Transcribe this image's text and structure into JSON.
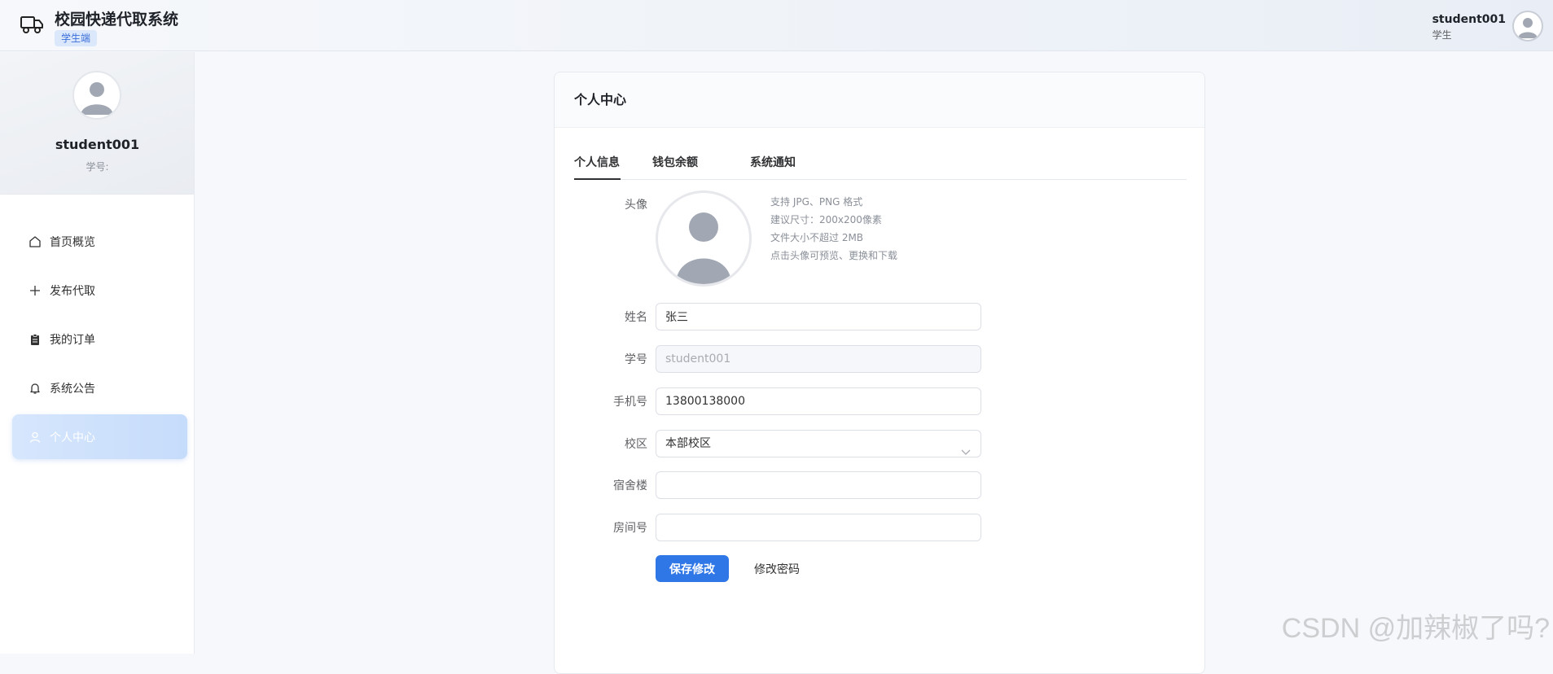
{
  "app": {
    "title": "校园快递代取系统",
    "role_tag": "学生端",
    "user_name": "student001",
    "user_role": "学生"
  },
  "sidebar": {
    "profile_name": "student001",
    "profile_sid_label": "学号:",
    "items": [
      {
        "label": "首页概览",
        "icon": "home-icon"
      },
      {
        "label": "发布代取",
        "icon": "plus-icon"
      },
      {
        "label": "我的订单",
        "icon": "clipboard-icon"
      },
      {
        "label": "系统公告",
        "icon": "bell-icon"
      },
      {
        "label": "个人中心",
        "icon": "user-icon",
        "active": true
      }
    ]
  },
  "card": {
    "title": "个人中心",
    "tabs": [
      "个人信息",
      "钱包余额",
      "系统通知"
    ],
    "active_tab": "个人信息"
  },
  "form": {
    "avatar_label": "头像",
    "tips": [
      "支持 JPG、PNG 格式",
      "建议尺寸：200x200像素",
      "文件大小不超过 2MB",
      "点击头像可预览、更换和下载"
    ],
    "name_label": "姓名",
    "name_value": "张三",
    "sid_label": "学号",
    "sid_value": "student001",
    "phone_label": "手机号",
    "phone_value": "13800138000",
    "campus_label": "校区",
    "campus_value": "本部校区",
    "dorm_label": "宿舍楼",
    "dorm_value": "",
    "room_label": "房间号",
    "room_value": "",
    "save_label": "保存修改",
    "password_label": "修改密码"
  },
  "watermark": "CSDN @加辣椒了吗?",
  "colors": {
    "primary": "#2f76e6",
    "active_menu": "#c6dcfb",
    "tag_bg": "#dbe7fb"
  }
}
